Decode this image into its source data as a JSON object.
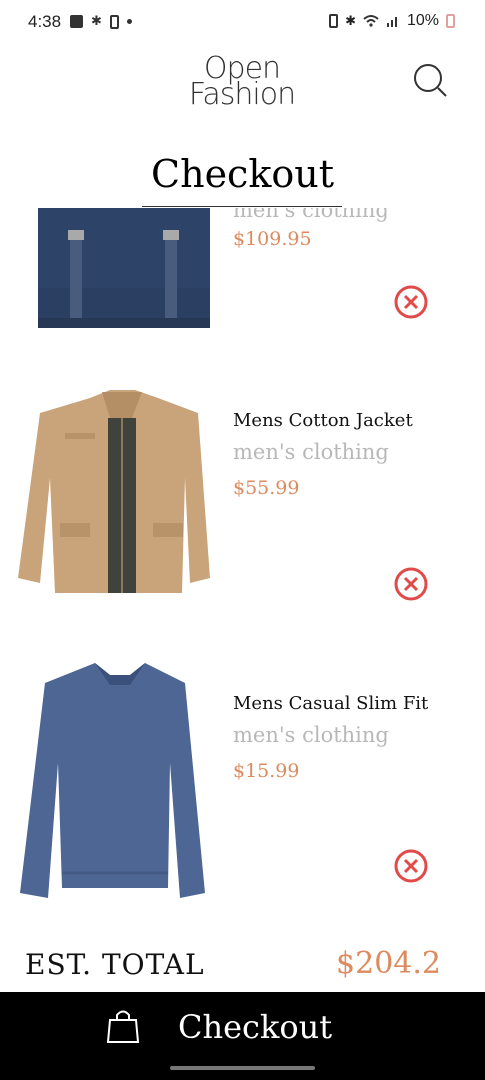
{
  "status_bar": {
    "time": "4:38",
    "battery": "10%"
  },
  "header": {
    "logo_line1": "Open",
    "logo_line2": "Fashion"
  },
  "page": {
    "title": "Checkout"
  },
  "items": [
    {
      "name": "",
      "category": "men's clothing",
      "price": "$109.95"
    },
    {
      "name": "Mens Cotton Jacket",
      "category": "men's clothing",
      "price": "$55.99"
    },
    {
      "name": "Mens Casual Slim Fit",
      "category": "men's clothing",
      "price": "$15.99"
    }
  ],
  "total": {
    "label": "EST. TOTAL",
    "value": "$204.2"
  },
  "checkout_bar": {
    "label": "Checkout"
  },
  "colors": {
    "price": "#dd8a5e",
    "category": "#b8b8b8",
    "remove": "#e24a4a",
    "bar": "#000000"
  },
  "icons": [
    "search-icon",
    "remove-icon",
    "shopping-bag-icon"
  ]
}
